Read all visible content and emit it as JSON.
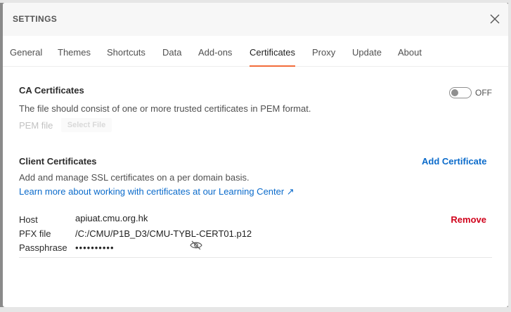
{
  "dialog": {
    "title": "SETTINGS"
  },
  "tabs": [
    {
      "label": "General"
    },
    {
      "label": "Themes"
    },
    {
      "label": "Shortcuts"
    },
    {
      "label": "Data"
    },
    {
      "label": "Add-ons"
    },
    {
      "label": "Certificates"
    },
    {
      "label": "Proxy"
    },
    {
      "label": "Update"
    },
    {
      "label": "About"
    }
  ],
  "active_tab": "Certificates",
  "ca": {
    "title": "CA Certificates",
    "toggle_label": "OFF",
    "toggle_on": false,
    "description": "The file should consist of one or more trusted certificates in PEM format.",
    "pem_label": "PEM file",
    "select_file": "Select File"
  },
  "client": {
    "title": "Client Certificates",
    "add_label": "Add Certificate",
    "description": "Add and manage SSL certificates on a per domain basis.",
    "learn_more": "Learn more about working with certificates at our Learning Center ↗",
    "certificate": {
      "host_label": "Host",
      "host": "apiuat.cmu.org.hk",
      "pfx_label": "PFX file",
      "pfx": "/C:/CMU/P1B_D3/CMU-TYBL-CERT01.p12",
      "pass_label": "Passphrase",
      "pass_masked": "••••••••••",
      "remove_label": "Remove"
    }
  },
  "colors": {
    "accent": "#f26b3a",
    "link": "#0b6bcb",
    "danger": "#d0021b"
  }
}
